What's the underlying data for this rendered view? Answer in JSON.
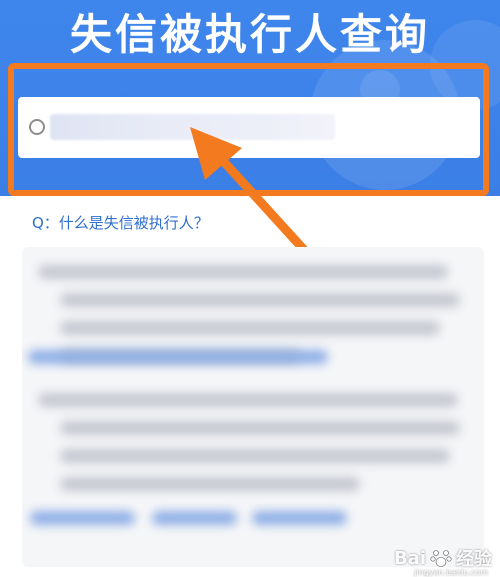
{
  "header": {
    "title": "失信被执行人查询"
  },
  "search": {
    "value": "",
    "placeholder": ""
  },
  "faq": {
    "question": "Q：什么是失信被执行人？"
  },
  "watermark": {
    "brand": "Bai",
    "brand_suffix": "经验",
    "url": "jingyan.baidu.com"
  },
  "colors": {
    "banner": "#3f86ec",
    "highlight": "#f47a20",
    "link": "#2f6fd1"
  },
  "icons": {
    "search_prefix": "radio-circle-icon",
    "annotation": "arrow-icon"
  }
}
